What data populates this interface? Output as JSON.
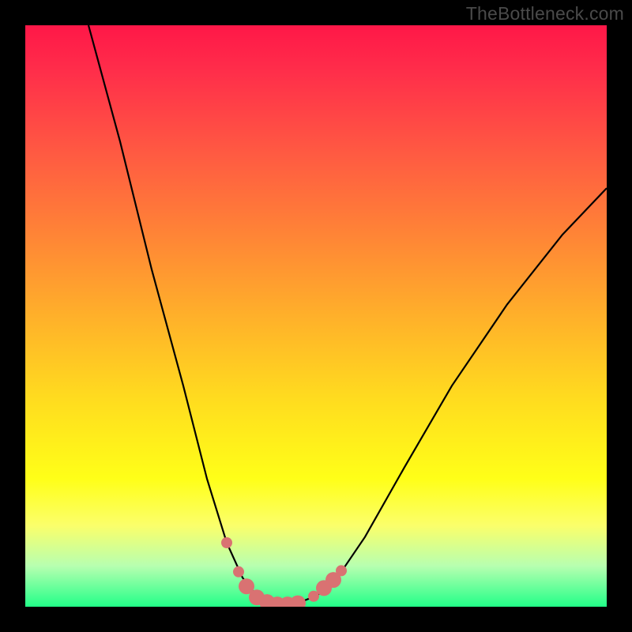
{
  "watermark": "TheBottleneck.com",
  "chart_data": {
    "type": "line",
    "title": "",
    "xlabel": "",
    "ylabel": "",
    "xlim": [
      0,
      736
    ],
    "ylim_bottleneck_pct": [
      0,
      100
    ],
    "note": "Qualitative bottleneck curve. y is bottleneck percentage (0 = green/optimal, 100 = red/severe). Minimum near x≈325.",
    "gradient_stops": [
      {
        "pct": 0,
        "color": "#ff1748"
      },
      {
        "pct": 8,
        "color": "#ff2e4a"
      },
      {
        "pct": 22,
        "color": "#ff5a42"
      },
      {
        "pct": 36,
        "color": "#ff8436"
      },
      {
        "pct": 50,
        "color": "#ffb02a"
      },
      {
        "pct": 64,
        "color": "#ffdb1f"
      },
      {
        "pct": 78,
        "color": "#ffff18"
      },
      {
        "pct": 86,
        "color": "#fbff6a"
      },
      {
        "pct": 93,
        "color": "#b7ffb0"
      },
      {
        "pct": 100,
        "color": "#22ff88"
      }
    ],
    "curves": [
      {
        "name": "bottleneck-curve",
        "points": [
          {
            "x": 80,
            "y_pct": 100
          },
          {
            "x": 120,
            "y_pct": 80
          },
          {
            "x": 160,
            "y_pct": 58
          },
          {
            "x": 200,
            "y_pct": 38
          },
          {
            "x": 230,
            "y_pct": 22
          },
          {
            "x": 255,
            "y_pct": 11
          },
          {
            "x": 275,
            "y_pct": 5
          },
          {
            "x": 295,
            "y_pct": 1.5
          },
          {
            "x": 310,
            "y_pct": 0.5
          },
          {
            "x": 325,
            "y_pct": 0.3
          },
          {
            "x": 345,
            "y_pct": 0.6
          },
          {
            "x": 370,
            "y_pct": 2
          },
          {
            "x": 395,
            "y_pct": 5
          },
          {
            "x": 430,
            "y_pct": 12
          },
          {
            "x": 480,
            "y_pct": 24
          },
          {
            "x": 540,
            "y_pct": 38
          },
          {
            "x": 610,
            "y_pct": 52
          },
          {
            "x": 680,
            "y_pct": 64
          },
          {
            "x": 736,
            "y_pct": 72
          }
        ]
      }
    ],
    "markers": {
      "color": "#d97272",
      "radius_small": 7,
      "radius_large": 10,
      "points": [
        {
          "x": 255,
          "y_pct": 11,
          "size": "small"
        },
        {
          "x": 270,
          "y_pct": 6,
          "size": "small"
        },
        {
          "x": 280,
          "y_pct": 3.5,
          "size": "large"
        },
        {
          "x": 293,
          "y_pct": 1.6,
          "size": "large"
        },
        {
          "x": 306,
          "y_pct": 0.8,
          "size": "large"
        },
        {
          "x": 319,
          "y_pct": 0.4,
          "size": "large"
        },
        {
          "x": 332,
          "y_pct": 0.4,
          "size": "large"
        },
        {
          "x": 345,
          "y_pct": 0.6,
          "size": "large"
        },
        {
          "x": 365,
          "y_pct": 1.8,
          "size": "small"
        },
        {
          "x": 378,
          "y_pct": 3.2,
          "size": "large"
        },
        {
          "x": 390,
          "y_pct": 4.6,
          "size": "large"
        },
        {
          "x": 400,
          "y_pct": 6.2,
          "size": "small"
        }
      ]
    }
  }
}
